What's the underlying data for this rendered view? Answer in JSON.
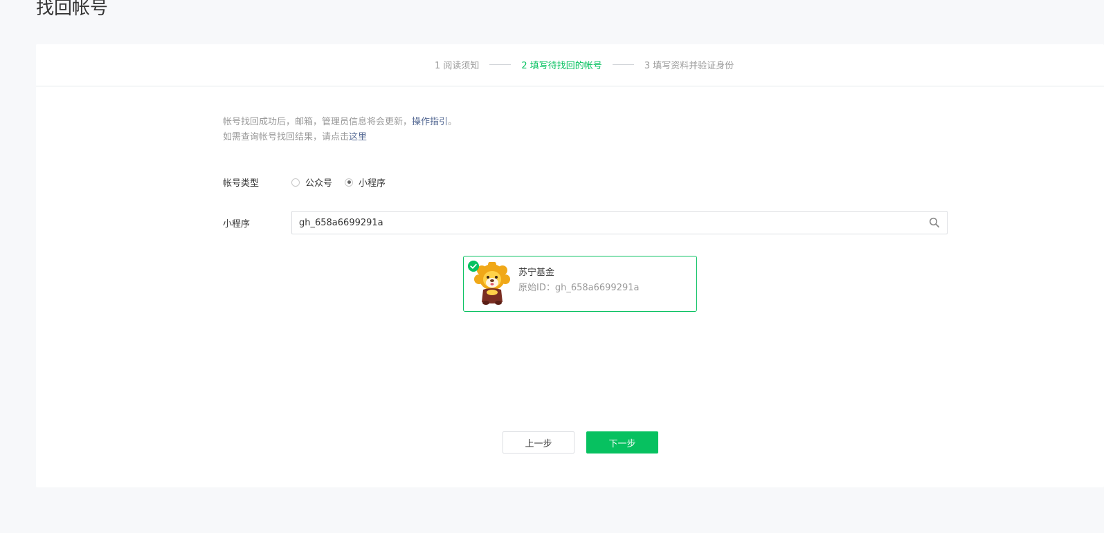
{
  "page": {
    "title": "找回帐号"
  },
  "steps": [
    {
      "label": "1 阅读须知",
      "active": false
    },
    {
      "label": "2 填写待找回的帐号",
      "active": true
    },
    {
      "label": "3 填写资料并验证身份",
      "active": false
    }
  ],
  "tips": {
    "line1_text": "帐号找回成功后，邮箱，管理员信息将会更新，",
    "line1_link": "操作指引",
    "line1_end": "。",
    "line2_text": "如需查询帐号找回结果，请点击",
    "line2_link": "这里"
  },
  "form": {
    "account_type_label": "帐号类型",
    "account_type_options": [
      {
        "label": "公众号",
        "checked": false
      },
      {
        "label": "小程序",
        "checked": true
      }
    ],
    "miniprogram_label": "小程序",
    "search_value": "gh_658a6699291a"
  },
  "result": {
    "name": "苏宁基金",
    "id_text": "原始ID：gh_658a6699291a",
    "selected": true
  },
  "buttons": {
    "prev_label": "上一步",
    "next_label": "下一步"
  },
  "colors": {
    "accent": "#07c160",
    "link": "#576b95",
    "muted": "#9a9a9a",
    "text": "#353535",
    "background": "#f7f8fa"
  }
}
